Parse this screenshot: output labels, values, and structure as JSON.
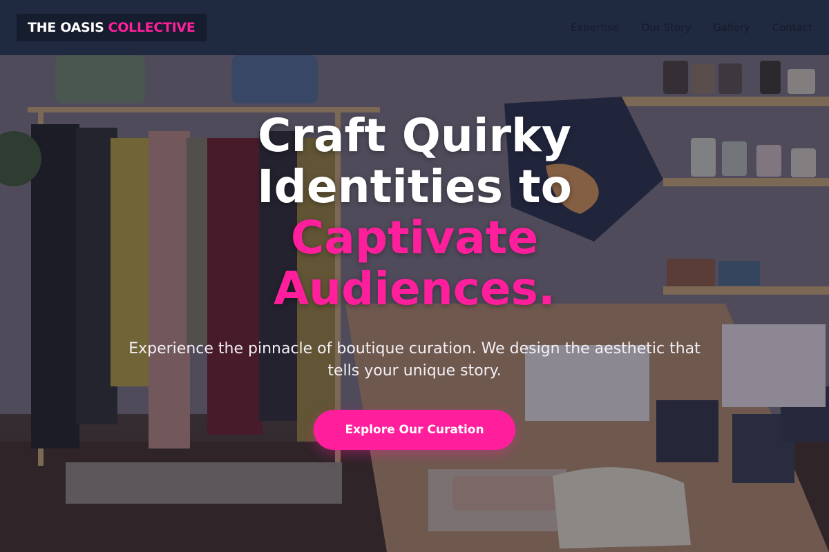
{
  "header": {
    "logo_primary": "THE OASIS",
    "logo_accent": "COLLECTIVE",
    "nav": [
      {
        "label": "Expertise"
      },
      {
        "label": "Our Story"
      },
      {
        "label": "Gallery"
      },
      {
        "label": "Contact"
      }
    ]
  },
  "hero": {
    "headline_line1": "Craft Quirky",
    "headline_line2": "Identities to",
    "headline_line3": "Captivate",
    "headline_line4": "Audiences.",
    "subheadline": "Experience the pinnacle of boutique curation. We design the aesthetic that tells your unique story.",
    "cta_label": "Explore Our Curation"
  },
  "colors": {
    "accent": "#ff1f9c",
    "header_bg": "#1f2a40",
    "logo_bg": "#151d2e",
    "text_light": "#ffffff"
  }
}
